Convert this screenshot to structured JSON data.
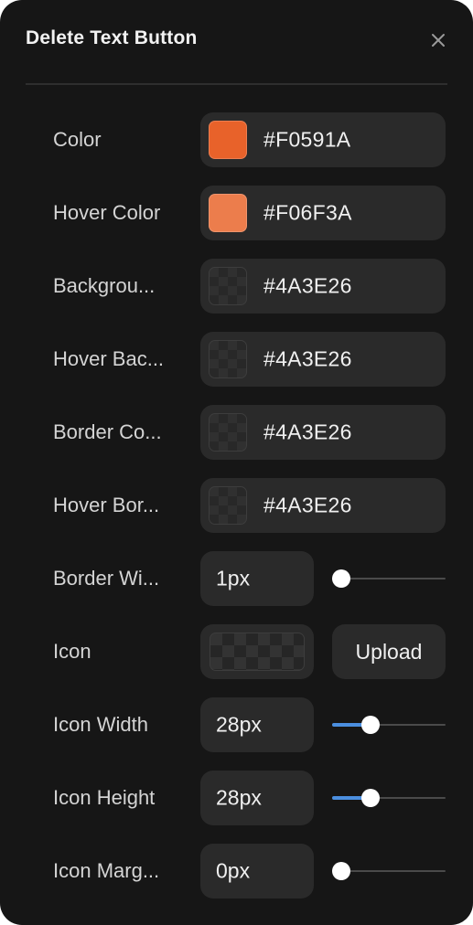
{
  "dialog": {
    "title": "Delete Text Button",
    "close_icon": "close-icon"
  },
  "color_rows": [
    {
      "label": "Color",
      "hex": "#F0591A",
      "swatch": "#E8622A",
      "transparent": false
    },
    {
      "label": "Hover Color",
      "hex": "#F06F3A",
      "swatch": "#EC7D4C",
      "transparent": false
    },
    {
      "label": "Backgrou...",
      "hex": "#4A3E26",
      "transparent": true
    },
    {
      "label": "Hover Bac...",
      "hex": "#4A3E26",
      "transparent": true
    },
    {
      "label": "Border Co...",
      "hex": "#4A3E26",
      "transparent": true
    },
    {
      "label": "Hover Bor...",
      "hex": "#4A3E26",
      "transparent": true
    }
  ],
  "border_width": {
    "label": "Border Wi...",
    "value": "1px",
    "slider_fraction": 0.0
  },
  "icon": {
    "label": "Icon",
    "upload_label": "Upload"
  },
  "icon_width": {
    "label": "Icon Width",
    "value": "28px",
    "slider_fraction": 0.31
  },
  "icon_height": {
    "label": "Icon Height",
    "value": "28px",
    "slider_fraction": 0.31
  },
  "icon_margin": {
    "label": "Icon Marg...",
    "value": "0px",
    "slider_fraction": 0.0
  },
  "colors": {
    "panel_bg": "#161616",
    "field_bg": "#2A2A2A",
    "slider_fill": "#4B8FE0"
  }
}
